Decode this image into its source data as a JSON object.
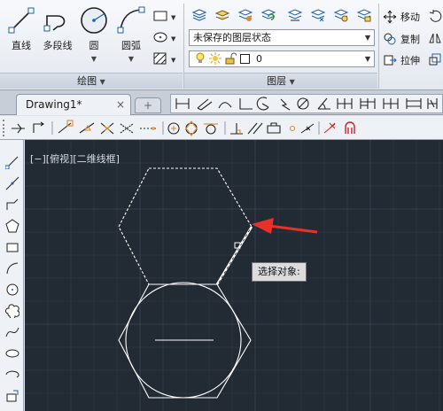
{
  "ribbon": {
    "draw": {
      "title": "绘图",
      "line": "直线",
      "polyline": "多段线",
      "circle": "圆",
      "arc": "圆弧"
    },
    "layers": {
      "title": "图层",
      "layer_state": "未保存的图层状态",
      "current_layer": "0"
    },
    "modify": {
      "move": "移动",
      "copy": "复制",
      "stretch": "拉伸"
    }
  },
  "tabs": {
    "active": "Drawing1*"
  },
  "canvas": {
    "view_label": "[−][俯视][二维线框]",
    "tooltip": "选择对象:"
  },
  "colors": {
    "canvas_bg": "#222a34",
    "grid": "#2c3541",
    "geometry": "#ffffff",
    "arrow": "#e8312a"
  }
}
